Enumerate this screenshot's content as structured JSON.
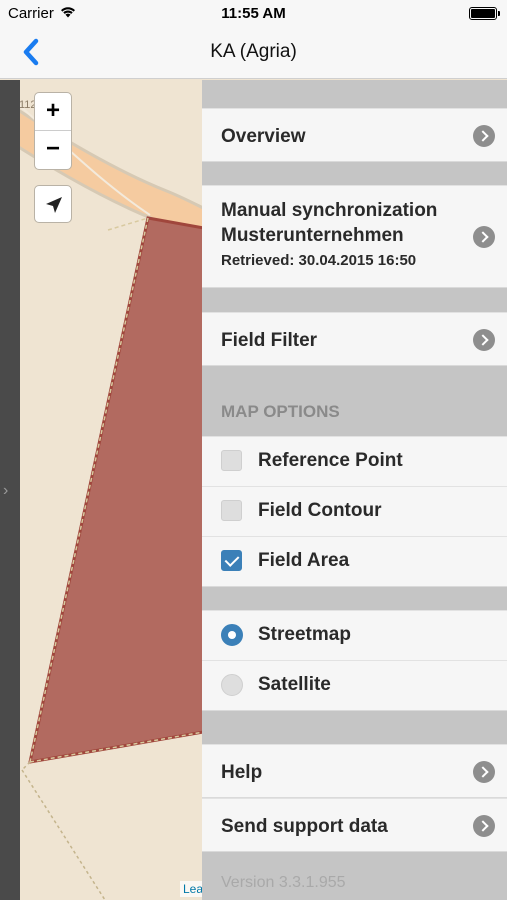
{
  "status_bar": {
    "carrier": "Carrier",
    "time": "11:55 AM"
  },
  "nav": {
    "title": "KA (Agria)",
    "back_icon": "back-chevron-icon"
  },
  "map": {
    "zoom_in_label": "+",
    "zoom_out_label": "−",
    "attribution": "Lea",
    "road_label": "112",
    "field_fill_color": "#b26a60",
    "field_stroke_color": "#a0463c"
  },
  "panel": {
    "overview_label": "Overview",
    "sync": {
      "line1": "Manual synchronization",
      "line2": "Musterunternehmen",
      "retrieved": "Retrieved: 30.04.2015 16:50"
    },
    "field_filter_label": "Field Filter",
    "map_options_header": "MAP OPTIONS",
    "options": [
      {
        "label": "Reference Point",
        "checked": false
      },
      {
        "label": "Field Contour",
        "checked": false
      },
      {
        "label": "Field Area",
        "checked": true
      }
    ],
    "map_types": [
      {
        "label": "Streetmap",
        "selected": true
      },
      {
        "label": "Satellite",
        "selected": false
      }
    ],
    "help_label": "Help",
    "support_label": "Send support data",
    "version": "Version 3.3.1.955",
    "accent_color": "#3b80b8"
  }
}
